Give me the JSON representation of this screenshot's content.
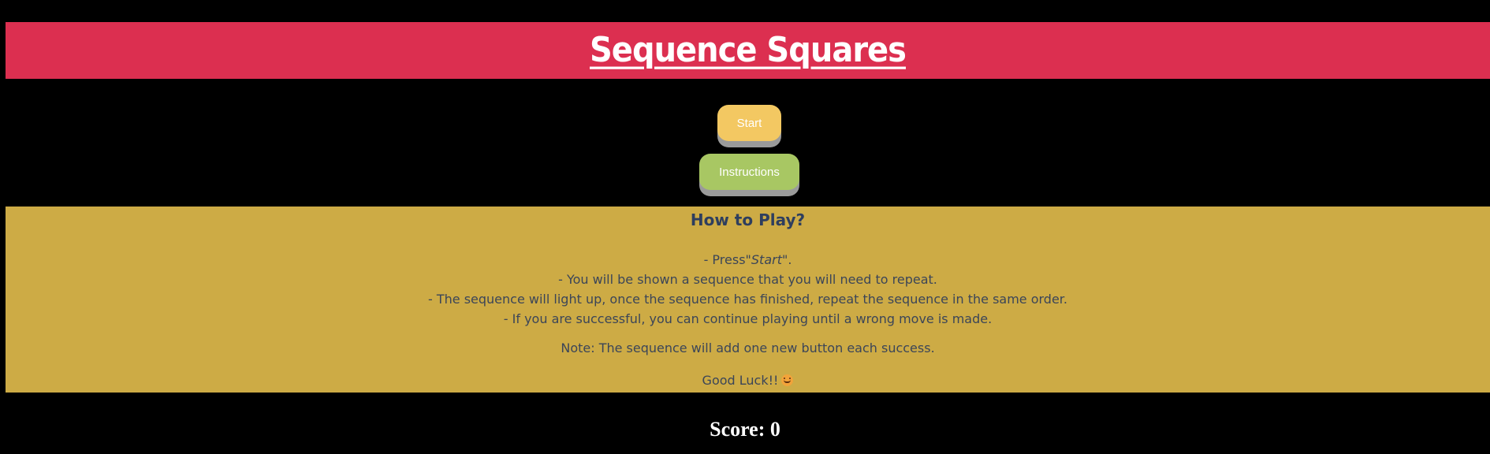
{
  "header": {
    "title": "Sequence Squares",
    "background": "#dc2f50"
  },
  "controls": {
    "start_label": "Start",
    "start_color": "#f3c862",
    "instructions_label": "Instructions",
    "instructions_color": "#a8c763"
  },
  "instructions": {
    "title": "How to Play?",
    "background": "#cdab45",
    "step1_prefix": "- Press",
    "step1_emphasis": "\"Start\"",
    "step1_suffix": ".",
    "step2": "- You will be shown a sequence that you will need to repeat.",
    "step3": "- The sequence will light up, once the sequence has finished, repeat the sequence in the same order.",
    "step4": "- If you are successful, you can continue playing until a wrong move is made.",
    "note": "Note: The sequence will add one new button each success.",
    "good_luck": "Good Luck!!",
    "good_luck_icon": "smiling-face-icon"
  },
  "score": {
    "label": "Score: ",
    "value": "0"
  }
}
